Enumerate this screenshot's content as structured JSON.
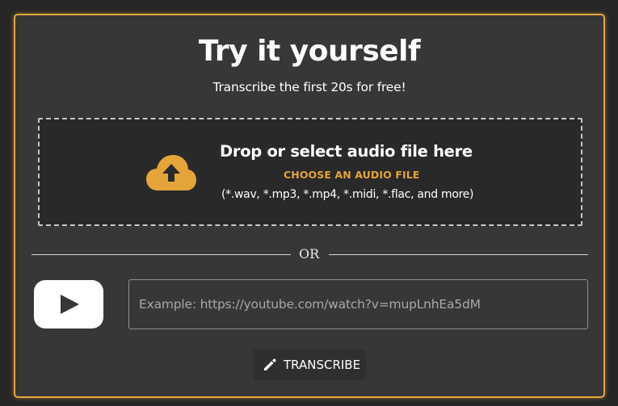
{
  "header": {
    "title": "Try it yourself",
    "subtitle": "Transcribe the first 20s for free!"
  },
  "upload": {
    "title": "Drop or select audio file here",
    "choose_label": "CHOOSE AN AUDIO FILE",
    "formats": "(*.wav, *.mp3, *.mp4, *.midi, *.flac, and more)",
    "icon": "cloud-upload-icon"
  },
  "divider": {
    "label": "OR"
  },
  "youtube": {
    "icon": "youtube-icon",
    "placeholder": "Example: https://youtube.com/watch?v=mupLnhEa5dM",
    "value": ""
  },
  "actions": {
    "transcribe_label": "TRANSCRIBE",
    "transcribe_icon": "pencil-icon"
  },
  "colors": {
    "accent": "#e5a43a",
    "card_background": "#383737",
    "page_background": "#262626",
    "dropzone_background": "#292929"
  }
}
